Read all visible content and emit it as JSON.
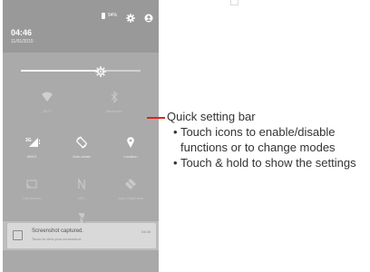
{
  "status": {
    "battery": "94%"
  },
  "clock": {
    "time": "04:46",
    "date": "11/01/2015"
  },
  "brightness": {
    "level": 0.67
  },
  "tiles": [
    {
      "label": "Wi-Fi",
      "icon": "wifi-icon",
      "active": false
    },
    {
      "label": "Bluetooth",
      "icon": "bluetooth-icon",
      "active": false
    },
    {
      "label": "46001",
      "icon": "signal-icon",
      "active": true,
      "badge": "3G"
    },
    {
      "label": "Auto-rotate",
      "icon": "rotate-icon",
      "active": true
    },
    {
      "label": "Location",
      "icon": "location-pin-icon",
      "active": true
    },
    {
      "label": "Cast screen",
      "icon": "cast-icon",
      "active": false
    },
    {
      "label": "NFC",
      "icon": "nfc-icon",
      "active": false
    },
    {
      "label": "Auto brightness",
      "icon": "auto-brightness-icon",
      "active": false
    },
    {
      "label": "Flashlight",
      "icon": "flashlight-icon",
      "active": false
    }
  ],
  "notification": {
    "title": "Screenshot captured.",
    "subtitle": "Touch to view your screenshot.",
    "time": "04:45"
  },
  "annotation": {
    "title": "Quick setting bar",
    "bullet1_line1": "Touch icons to enable/disable",
    "bullet1_line2": "functions or to change modes",
    "bullet2": "Touch & hold to show the settings"
  },
  "colors": {
    "callout": "#e1241b",
    "panel": "#aaaaaa",
    "header": "#999999",
    "text": "#333333"
  }
}
